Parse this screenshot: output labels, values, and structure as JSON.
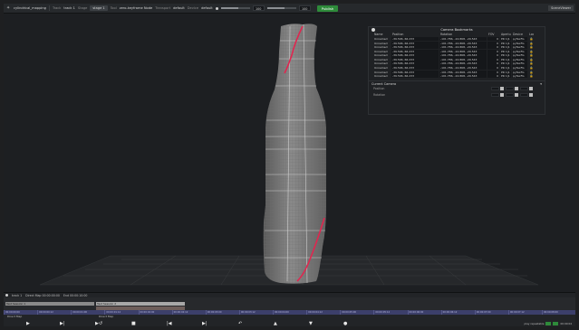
{
  "toolbar": {
    "logo_icon": "app-logo-icon",
    "project_name": "cylindrical_mapping",
    "track_label": "Track",
    "track_value": "track 1",
    "stage_label": "Stage",
    "stage_value": "stage 1",
    "tool_label": "Tool",
    "tool_value": "zero-keyframe Node",
    "transport_label": "Transport",
    "transport_value": "default",
    "device_label": "Device",
    "device_value": "default",
    "speed_value": "100",
    "zoom_value": "100",
    "publish_label": "Publish",
    "right_button": "SceneViewer"
  },
  "bookmarks": {
    "title": "Camera Bookmarks",
    "columns": [
      "Name",
      "Position",
      "Rotation",
      "FOV",
      "Aperture",
      "Device",
      "Lock"
    ],
    "rows": [
      {
        "name": "Unnamed",
        "position": "-39.506, 66.233",
        "rotation": "-101.786, -24.868, -29.543",
        "fov": "0",
        "aperture": "PR 1|1",
        "device": "pyTexFG"
      },
      {
        "name": "Unnamed",
        "position": "-39.506, 66.233",
        "rotation": "-101.786, -24.868, -29.543",
        "fov": "0",
        "aperture": "PR 1|1",
        "device": "pyTexFG"
      },
      {
        "name": "Unnamed",
        "position": "-39.506, 66.233",
        "rotation": "-101.786, -24.868, -29.543",
        "fov": "0",
        "aperture": "PR 1|1",
        "device": "pyTexFG"
      },
      {
        "name": "Unnamed",
        "position": "-39.506, 66.233",
        "rotation": "-101.786, -24.868, -29.543",
        "fov": "0",
        "aperture": "PR 1|1",
        "device": "pyTexFG"
      },
      {
        "name": "Unnamed",
        "position": "-39.506, 66.233",
        "rotation": "-101.786, -24.868, -29.543",
        "fov": "0",
        "aperture": "PR 1|1",
        "device": "pyTexFG"
      },
      {
        "name": "Unnamed",
        "position": "-39.506, 66.233",
        "rotation": "-101.786, -24.868, -29.543",
        "fov": "0",
        "aperture": "PR 1|1",
        "device": "pyTexFG"
      },
      {
        "name": "Unnamed",
        "position": "-39.506, 66.233",
        "rotation": "-101.786, -24.868, -29.543",
        "fov": "0",
        "aperture": "PR 1|1",
        "device": "pyTexFG"
      },
      {
        "name": "Unnamed",
        "position": "-39.506, 66.233",
        "rotation": "-101.786, -24.868, -29.543",
        "fov": "0",
        "aperture": "PR 1|1",
        "device": "pyTexFG"
      },
      {
        "name": "Unnamed",
        "position": "-39.506, 66.233",
        "rotation": "-101.786, -24.868, -29.543",
        "fov": "0",
        "aperture": "PR 1|1",
        "device": "pyTexFG"
      },
      {
        "name": "Unnamed",
        "position": "-39.506, 66.233",
        "rotation": "-101.786, -24.868, -29.543",
        "fov": "0",
        "aperture": "PR 1|1",
        "device": "pyTexFG"
      }
    ],
    "current_camera_label": "Current Camera",
    "position_label": "Position",
    "rotation_label": "Rotation"
  },
  "timeline": {
    "track_name": "track 1",
    "direct_map": "Direct Map 00:00:00:00",
    "end_time": "End 00:00:10:00",
    "clip1": "Test Session 1",
    "clip2": "Test Session 2",
    "ruler": [
      "00:00:00:00",
      "00:00:00:12",
      "00:00:01:00",
      "00:00:01:12",
      "00:00:02:00",
      "00:00:02:12",
      "00:00:03:00",
      "00:00:03:12",
      "00:00:04:00",
      "00:00:04:12",
      "00:00:05:00",
      "00:00:05:12",
      "00:00:06:00",
      "00:00:06:12",
      "00:00:07:00",
      "00:00:07:12",
      "00:00:08:00"
    ],
    "sub_left": "Direct Map",
    "sub_mid": "Direct Map",
    "right_status": "play repeatable",
    "right_time": "00:00:04"
  },
  "colors": {
    "accent_green": "#2e8b3a",
    "line_red": "#e0264f",
    "ruler_blue": "#3c3f6a"
  }
}
